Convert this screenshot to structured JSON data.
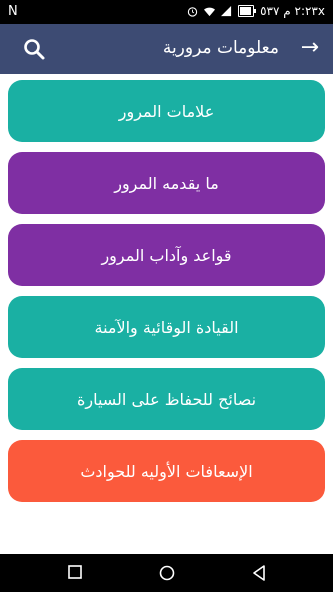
{
  "status_bar": {
    "left_letter": "N",
    "time": "٢:٢٣ م ٥٣٧x"
  },
  "app_bar": {
    "title": "معلومات مرورية",
    "back_icon": "arrow-right-icon",
    "search_icon": "search-icon"
  },
  "menu": {
    "items": [
      {
        "label": "علامات المرور",
        "color": "#1ab0a3"
      },
      {
        "label": "ما يقدمه المرور",
        "color": "#7f2fa3"
      },
      {
        "label": "قواعد وآداب المرور",
        "color": "#7f2fa3"
      },
      {
        "label": "القيادة الوقائية والآمنة",
        "color": "#1ab0a3"
      },
      {
        "label": "نصائح للحفاظ على السيارة",
        "color": "#1ab0a3"
      },
      {
        "label": "الإسعافات الأوليه للحوادث",
        "color": "#fb5a3c"
      }
    ]
  },
  "nav_bar": {
    "icons": [
      "recents-square-icon",
      "home-circle-icon",
      "back-triangle-icon"
    ]
  },
  "colors": {
    "app_bar": "#3d4b73",
    "teal": "#1ab0a3",
    "purple": "#7f2fa3",
    "orange": "#fb5a3c"
  }
}
